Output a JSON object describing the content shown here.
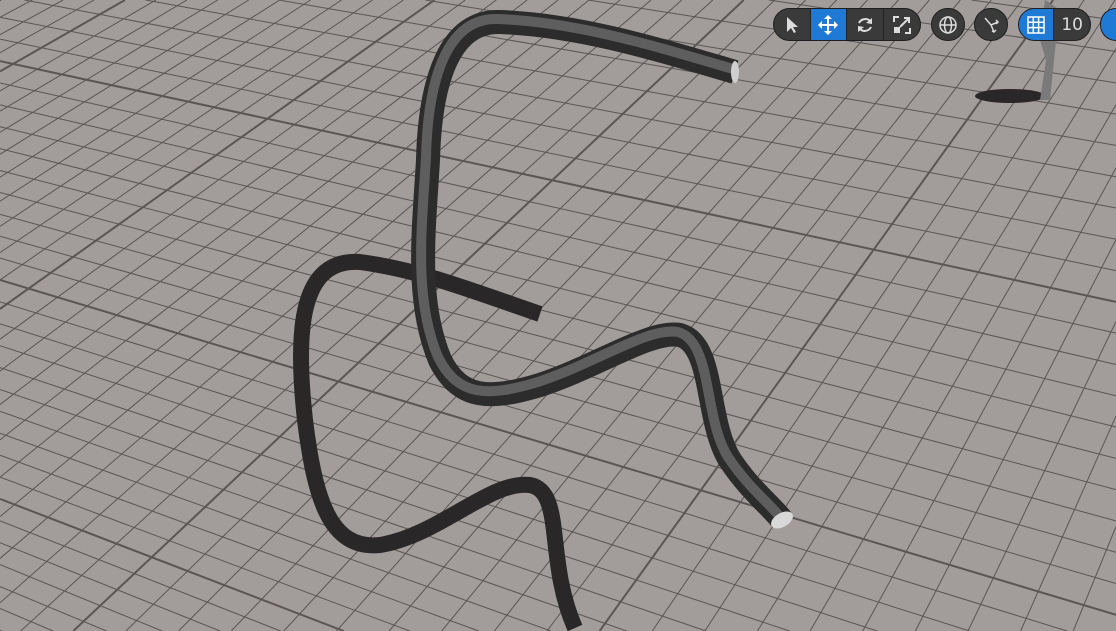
{
  "toolbar": {
    "transform_tools": [
      {
        "name": "select",
        "icon": "cursor-icon",
        "active": false
      },
      {
        "name": "translate",
        "icon": "move-icon",
        "active": true
      },
      {
        "name": "rotate",
        "icon": "rotate-icon",
        "active": false
      },
      {
        "name": "scale",
        "icon": "scale-icon",
        "active": false
      }
    ],
    "coordinate_space_icon": "globe-icon",
    "surface_snap_icon": "surface-snap-icon",
    "grid_snap": {
      "icon": "grid-icon",
      "active": true,
      "value": "10"
    },
    "accent": "#1f7ad6"
  }
}
